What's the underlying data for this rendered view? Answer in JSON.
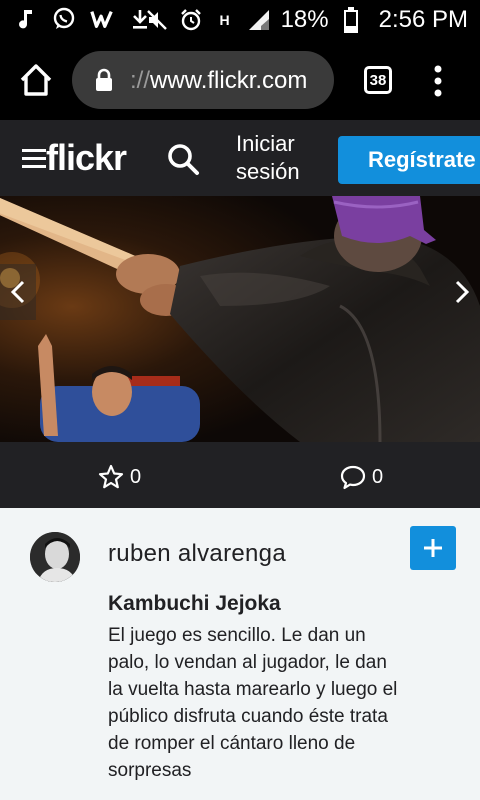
{
  "status_bar": {
    "battery_percent": "18%",
    "time": "2:56 PM",
    "network_label": "H"
  },
  "browser": {
    "url_prefix": "://",
    "url_host": "www.flickr.com",
    "tab_count": "38"
  },
  "header": {
    "logo": "flickr",
    "login_label": "Iniciar sesión",
    "signup_label": "Regístrate"
  },
  "stats": {
    "favorites_count": "0",
    "comments_count": "0"
  },
  "photo_info": {
    "author": "ruben alvarenga",
    "title": "Kambuchi Jejoka",
    "description": "El juego es sencillo. Le dan un palo, lo vendan al jugador, le dan la vuelta hasta marearlo y luego el público disfruta cuando éste trata de romper el cántaro lleno de sorpresas"
  },
  "colors": {
    "accent": "#128fdc",
    "header_bg": "#212124",
    "info_bg": "#f2f5f6"
  }
}
